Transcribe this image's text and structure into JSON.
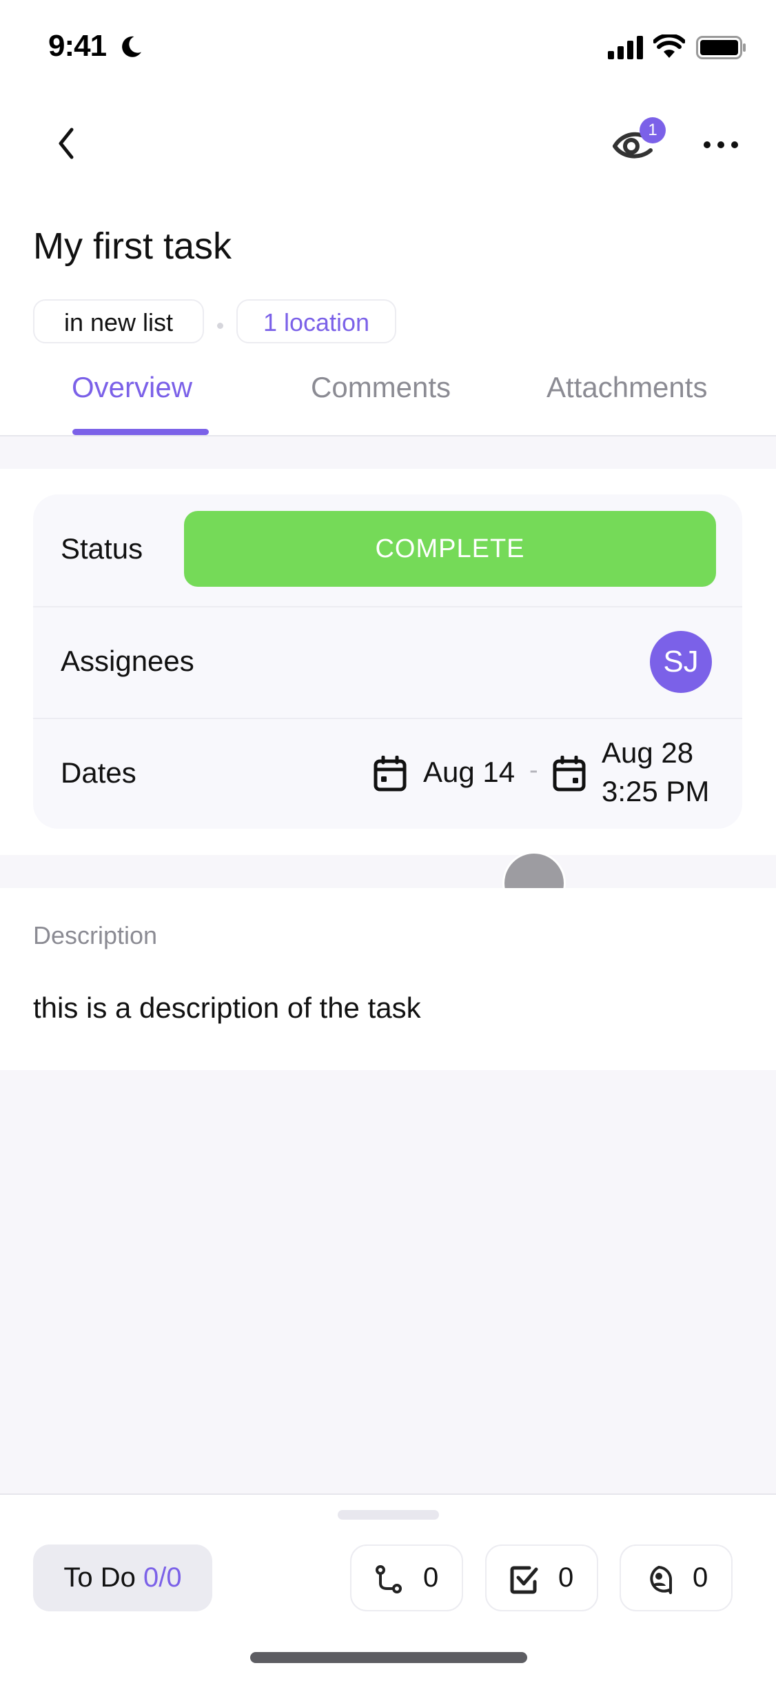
{
  "status_bar": {
    "time": "9:41",
    "focus_icon": "moon-icon",
    "icons": [
      "cellular-signal-icon",
      "wifi-icon",
      "battery-icon"
    ]
  },
  "header": {
    "back_icon": "chevron-left-icon",
    "watchers_icon": "eye-icon",
    "watchers_count": "1",
    "more_icon": "more-horizontal-icon"
  },
  "task": {
    "title": "My first task",
    "list_chip": "in new list",
    "location_chip": "1 location"
  },
  "tabs": [
    {
      "label": "Overview",
      "active": true
    },
    {
      "label": "Comments",
      "active": false
    },
    {
      "label": "Attachments",
      "active": false
    }
  ],
  "details": {
    "status_label": "Status",
    "status_value": "COMPLETE",
    "assignees_label": "Assignees",
    "assignee_initials": "SJ",
    "dates_label": "Dates",
    "start_date": "Aug 14",
    "date_separator": "-",
    "end_date_line1": "Aug 28",
    "end_date_line2": "3:25 PM"
  },
  "description": {
    "label": "Description",
    "text": "this is a description of the task"
  },
  "bottom_bar": {
    "todo_label": "To Do",
    "todo_count": "0/0",
    "dependencies_count": "0",
    "checklist_count": "0",
    "mentions_count": "0"
  },
  "colors": {
    "accent": "#7b61e8",
    "status_complete": "#75da58",
    "background": "#f7f6fa",
    "muted_text": "#8b8b93"
  }
}
